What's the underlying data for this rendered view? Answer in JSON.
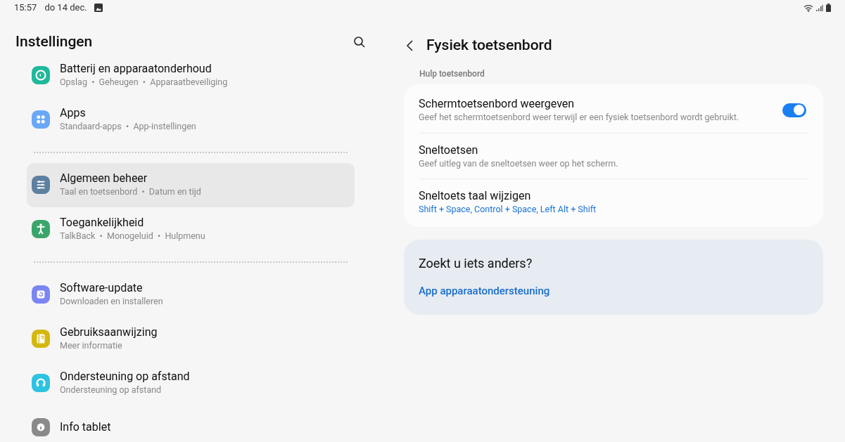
{
  "status_bar": {
    "time": "15:57",
    "date": "do 14 dec."
  },
  "sidebar": {
    "title": "Instellingen",
    "items": [
      {
        "kind": "item",
        "color": "#1fb89a",
        "title": "Batterij en apparaatonderhoud",
        "subtitle": "Opslag  •  Geheugen  •  Apparaatbeveiliging",
        "selected": false
      },
      {
        "kind": "item",
        "color": "#6aa8f7",
        "title": "Apps",
        "subtitle": "Standaard-apps  •  App-instellingen",
        "selected": false
      },
      {
        "kind": "divider"
      },
      {
        "kind": "item",
        "color": "#5d7fa0",
        "title": "Algemeen beheer",
        "subtitle": "Taal en toetsenbord  •  Datum en tijd",
        "selected": true
      },
      {
        "kind": "item",
        "color": "#3aa56a",
        "title": "Toegankelijkheid",
        "subtitle": "TalkBack  •  Monogeluid  •  Hulpmenu",
        "selected": false
      },
      {
        "kind": "divider"
      },
      {
        "kind": "item",
        "color": "#7c86f2",
        "title": "Software-update",
        "subtitle": "Downloaden en installeren",
        "selected": false
      },
      {
        "kind": "item",
        "color": "#d4b80f",
        "title": "Gebruiksaanwijzing",
        "subtitle": "Meer informatie",
        "selected": false
      },
      {
        "kind": "item",
        "color": "#2ec3e0",
        "title": "Ondersteuning op afstand",
        "subtitle": "Ondersteuning op afstand",
        "selected": false
      },
      {
        "kind": "item",
        "color": "#8a8a8a",
        "title": "Info tablet",
        "selected": false
      }
    ]
  },
  "detail": {
    "title": "Fysiek toetsenbord",
    "section": "Hulp toetsenbord",
    "rows": [
      {
        "kind": "toggle",
        "title": "Schermtoetsenbord weergeven",
        "subtitle": "Geef het schermtoetsenbord weer terwijl er een fysiek toetsenbord wordt gebruikt.",
        "on": true
      },
      {
        "kind": "plain",
        "title": "Sneltoetsen",
        "subtitle": "Geef uitleg van de sneltoetsen weer op het scherm."
      },
      {
        "kind": "value",
        "title": "Sneltoets taal wijzigen",
        "subtitle": "Shift + Space, Control + Space, Left Alt + Shift"
      }
    ],
    "help": {
      "title": "Zoekt u iets anders?",
      "link": "App apparaatondersteuning"
    }
  }
}
